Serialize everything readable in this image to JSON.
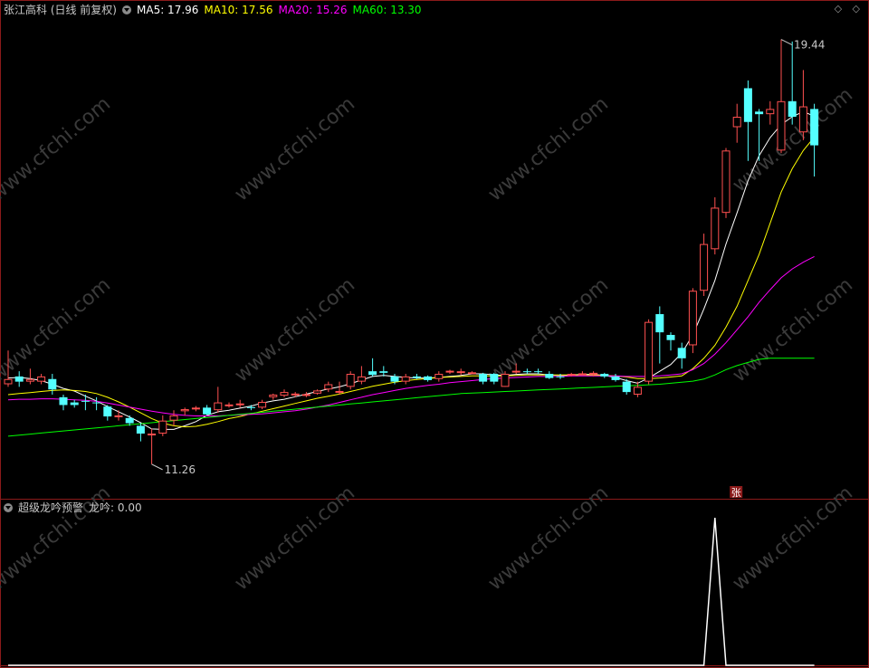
{
  "header": {
    "stock_label": "张江高科 (日线 前复权)",
    "ma5": "MA5: 17.96",
    "ma10": "MA10: 17.56",
    "ma20": "MA20: 15.26",
    "ma60": "MA60: 13.30",
    "ma5_color": "#ffffff",
    "ma10_color": "#ffff00",
    "ma20_color": "#ff00ff",
    "ma60_color": "#00ff00"
  },
  "top_controls": "◇ ◇",
  "price_panel": {
    "high_label": "19.44",
    "low_label": "11.26",
    "limit_up_marker": "张",
    "up_color": "#ff5050",
    "down_color": "#54ffff"
  },
  "indicator_panel": {
    "name": "超级龙吟预警",
    "value_text": "龙吟: 0.00",
    "line_color": "#ffffff"
  },
  "watermark": "www.cfchi.com",
  "chart_data": {
    "type": "candlestick",
    "price_range": [
      10.7,
      19.85
    ],
    "candles": [
      [
        12.8,
        12.9,
        13.45,
        12.75
      ],
      [
        12.95,
        12.85,
        13.05,
        12.75
      ],
      [
        12.85,
        12.9,
        13.1,
        12.8
      ],
      [
        12.85,
        12.95,
        13.0,
        12.8
      ],
      [
        12.9,
        12.7,
        13.0,
        12.6
      ],
      [
        12.55,
        12.4,
        12.6,
        12.3
      ],
      [
        12.45,
        12.4,
        12.5,
        12.35
      ],
      [
        12.48,
        12.47,
        12.6,
        12.3
      ],
      [
        12.45,
        12.44,
        12.55,
        12.3
      ],
      [
        12.37,
        12.18,
        12.4,
        12.1
      ],
      [
        12.2,
        12.2,
        12.3,
        12.1
      ],
      [
        12.15,
        12.05,
        12.2,
        12.0
      ],
      [
        12.0,
        11.85,
        12.05,
        11.7
      ],
      [
        11.82,
        11.85,
        11.95,
        11.26
      ],
      [
        11.85,
        12.1,
        12.2,
        11.8
      ],
      [
        12.1,
        12.2,
        12.3,
        12.0
      ],
      [
        12.28,
        12.32,
        12.35,
        12.2
      ],
      [
        12.33,
        12.35,
        12.38,
        12.28
      ],
      [
        12.35,
        12.22,
        12.4,
        12.2
      ],
      [
        12.3,
        12.45,
        12.75,
        12.25
      ],
      [
        12.4,
        12.41,
        12.45,
        12.35
      ],
      [
        12.42,
        12.43,
        12.5,
        12.35
      ],
      [
        12.36,
        12.34,
        12.4,
        12.3
      ],
      [
        12.35,
        12.46,
        12.5,
        12.32
      ],
      [
        12.55,
        12.6,
        12.62,
        12.5
      ],
      [
        12.58,
        12.65,
        12.7,
        12.55
      ],
      [
        12.6,
        12.62,
        12.65,
        12.55
      ],
      [
        12.6,
        12.61,
        12.65,
        12.55
      ],
      [
        12.62,
        12.68,
        12.7,
        12.6
      ],
      [
        12.7,
        12.8,
        12.85,
        12.65
      ],
      [
        12.65,
        12.67,
        12.85,
        12.6
      ],
      [
        12.75,
        13.0,
        13.05,
        12.7
      ],
      [
        12.85,
        12.95,
        13.15,
        12.8
      ],
      [
        13.05,
        12.98,
        13.3,
        12.95
      ],
      [
        13.05,
        13.02,
        13.15,
        12.95
      ],
      [
        12.95,
        12.85,
        13.0,
        12.8
      ],
      [
        12.85,
        12.95,
        13.0,
        12.8
      ],
      [
        12.95,
        12.92,
        13.0,
        12.9
      ],
      [
        12.95,
        12.88,
        12.97,
        12.85
      ],
      [
        12.9,
        13.0,
        13.05,
        12.85
      ],
      [
        13.05,
        13.06,
        13.08,
        13.0
      ],
      [
        13.02,
        13.05,
        13.1,
        12.98
      ],
      [
        13.02,
        13.03,
        13.05,
        13.0
      ],
      [
        13.0,
        12.85,
        13.02,
        12.8
      ],
      [
        13.0,
        12.85,
        13.02,
        12.8
      ],
      [
        12.75,
        13.0,
        13.05,
        12.75
      ],
      [
        13.05,
        13.06,
        13.2,
        13.0
      ],
      [
        13.05,
        13.04,
        13.1,
        13.0
      ],
      [
        13.05,
        13.04,
        13.1,
        13.0
      ],
      [
        13.0,
        12.92,
        13.05,
        12.9
      ],
      [
        12.95,
        12.94,
        13.0,
        12.9
      ],
      [
        12.98,
        13.0,
        13.02,
        12.95
      ],
      [
        13.0,
        13.01,
        13.05,
        12.98
      ],
      [
        13.0,
        13.02,
        13.05,
        12.95
      ],
      [
        13.0,
        12.95,
        13.02,
        12.92
      ],
      [
        12.95,
        12.88,
        13.0,
        12.85
      ],
      [
        12.85,
        12.65,
        12.9,
        12.6
      ],
      [
        12.6,
        12.75,
        12.85,
        12.55
      ],
      [
        12.85,
        14.0,
        14.05,
        12.8
      ],
      [
        14.15,
        13.8,
        14.3,
        13.2
      ],
      [
        13.75,
        13.65,
        13.8,
        13.45
      ],
      [
        13.5,
        13.3,
        13.6,
        13.1
      ],
      [
        13.55,
        14.6,
        14.65,
        13.4
      ],
      [
        14.6,
        15.5,
        15.7,
        14.5
      ],
      [
        15.4,
        16.2,
        16.4,
        15.3
      ],
      [
        16.1,
        17.3,
        17.35,
        16.0
      ],
      [
        17.75,
        17.95,
        18.2,
        17.45
      ],
      [
        18.5,
        17.85,
        18.65,
        17.1
      ],
      [
        18.05,
        18.0,
        18.1,
        17.1
      ],
      [
        18.0,
        18.1,
        18.25,
        17.8
      ],
      [
        17.3,
        18.25,
        19.44,
        17.25
      ],
      [
        18.25,
        17.95,
        19.4,
        17.8
      ],
      [
        17.65,
        18.15,
        18.85,
        17.5
      ],
      [
        18.1,
        17.4,
        18.2,
        16.8
      ]
    ],
    "ma_series": [
      {
        "name": "MA5",
        "color": "#ffffff",
        "values": [
          12.92,
          12.93,
          12.91,
          12.87,
          12.8,
          12.72,
          12.67,
          12.57,
          12.48,
          12.37,
          12.27,
          12.17,
          12.06,
          11.94,
          11.93,
          11.93,
          12.0,
          12.08,
          12.2,
          12.27,
          12.3,
          12.34,
          12.38,
          12.44,
          12.48,
          12.51,
          12.56,
          12.61,
          12.66,
          12.71,
          12.75,
          12.81,
          12.88,
          12.95,
          12.97,
          12.95,
          12.93,
          12.92,
          12.92,
          12.93,
          12.95,
          12.97,
          13.0,
          13.0,
          12.98,
          12.97,
          12.99,
          13.0,
          13.0,
          12.98,
          12.97,
          12.98,
          12.99,
          12.99,
          12.97,
          12.93,
          12.87,
          12.82,
          12.92,
          13.05,
          13.18,
          13.4,
          13.75,
          14.25,
          14.8,
          15.5,
          16.1,
          16.72,
          17.2,
          17.55,
          17.8,
          17.95,
          18.05,
          17.96
        ]
      },
      {
        "name": "MA10",
        "color": "#ffff00",
        "values": [
          12.6,
          12.62,
          12.64,
          12.66,
          12.68,
          12.69,
          12.68,
          12.66,
          12.62,
          12.55,
          12.46,
          12.36,
          12.25,
          12.14,
          12.05,
          12.0,
          11.98,
          11.99,
          12.03,
          12.08,
          12.14,
          12.18,
          12.23,
          12.28,
          12.33,
          12.38,
          12.43,
          12.48,
          12.53,
          12.57,
          12.61,
          12.66,
          12.71,
          12.76,
          12.8,
          12.84,
          12.87,
          12.89,
          12.91,
          12.93,
          12.94,
          12.95,
          12.96,
          12.96,
          12.96,
          12.96,
          12.97,
          12.98,
          12.98,
          12.98,
          12.98,
          12.98,
          12.98,
          12.98,
          12.97,
          12.96,
          12.94,
          12.91,
          12.91,
          12.92,
          12.94,
          12.96,
          13.1,
          13.3,
          13.55,
          13.9,
          14.3,
          14.8,
          15.3,
          15.9,
          16.5,
          16.95,
          17.3,
          17.56
        ]
      },
      {
        "name": "MA20",
        "color": "#ff00ff",
        "values": [
          12.5,
          12.51,
          12.51,
          12.52,
          12.52,
          12.51,
          12.5,
          12.49,
          12.47,
          12.44,
          12.4,
          12.36,
          12.32,
          12.28,
          12.25,
          12.22,
          12.2,
          12.19,
          12.19,
          12.19,
          12.2,
          12.21,
          12.22,
          12.23,
          12.25,
          12.27,
          12.29,
          12.32,
          12.36,
          12.4,
          12.45,
          12.5,
          12.55,
          12.6,
          12.64,
          12.68,
          12.72,
          12.75,
          12.78,
          12.8,
          12.83,
          12.85,
          12.87,
          12.89,
          12.91,
          12.92,
          12.93,
          12.94,
          12.95,
          12.95,
          12.95,
          12.96,
          12.96,
          12.96,
          12.96,
          12.96,
          12.95,
          12.95,
          12.95,
          12.96,
          12.98,
          13.0,
          13.08,
          13.2,
          13.38,
          13.6,
          13.85,
          14.1,
          14.38,
          14.62,
          14.85,
          15.02,
          15.15,
          15.26
        ]
      },
      {
        "name": "MA60",
        "color": "#00ff00",
        "values": [
          11.8,
          11.82,
          11.84,
          11.86,
          11.88,
          11.9,
          11.92,
          11.94,
          11.96,
          11.98,
          12.0,
          12.02,
          12.04,
          12.06,
          12.08,
          12.1,
          12.12,
          12.14,
          12.16,
          12.18,
          12.2,
          12.22,
          12.24,
          12.26,
          12.28,
          12.3,
          12.32,
          12.34,
          12.36,
          12.38,
          12.4,
          12.42,
          12.44,
          12.46,
          12.48,
          12.5,
          12.52,
          12.54,
          12.56,
          12.58,
          12.6,
          12.62,
          12.63,
          12.64,
          12.65,
          12.66,
          12.67,
          12.68,
          12.69,
          12.7,
          12.71,
          12.72,
          12.73,
          12.74,
          12.75,
          12.76,
          12.77,
          12.78,
          12.79,
          12.8,
          12.82,
          12.84,
          12.86,
          12.9,
          12.98,
          13.08,
          13.16,
          13.22,
          13.28,
          13.3,
          13.3,
          13.3,
          13.3,
          13.3
        ]
      }
    ],
    "indicator": {
      "name": "龙吟",
      "range": [
        0,
        1
      ],
      "spike_index": 64,
      "spike_value": 1
    }
  }
}
